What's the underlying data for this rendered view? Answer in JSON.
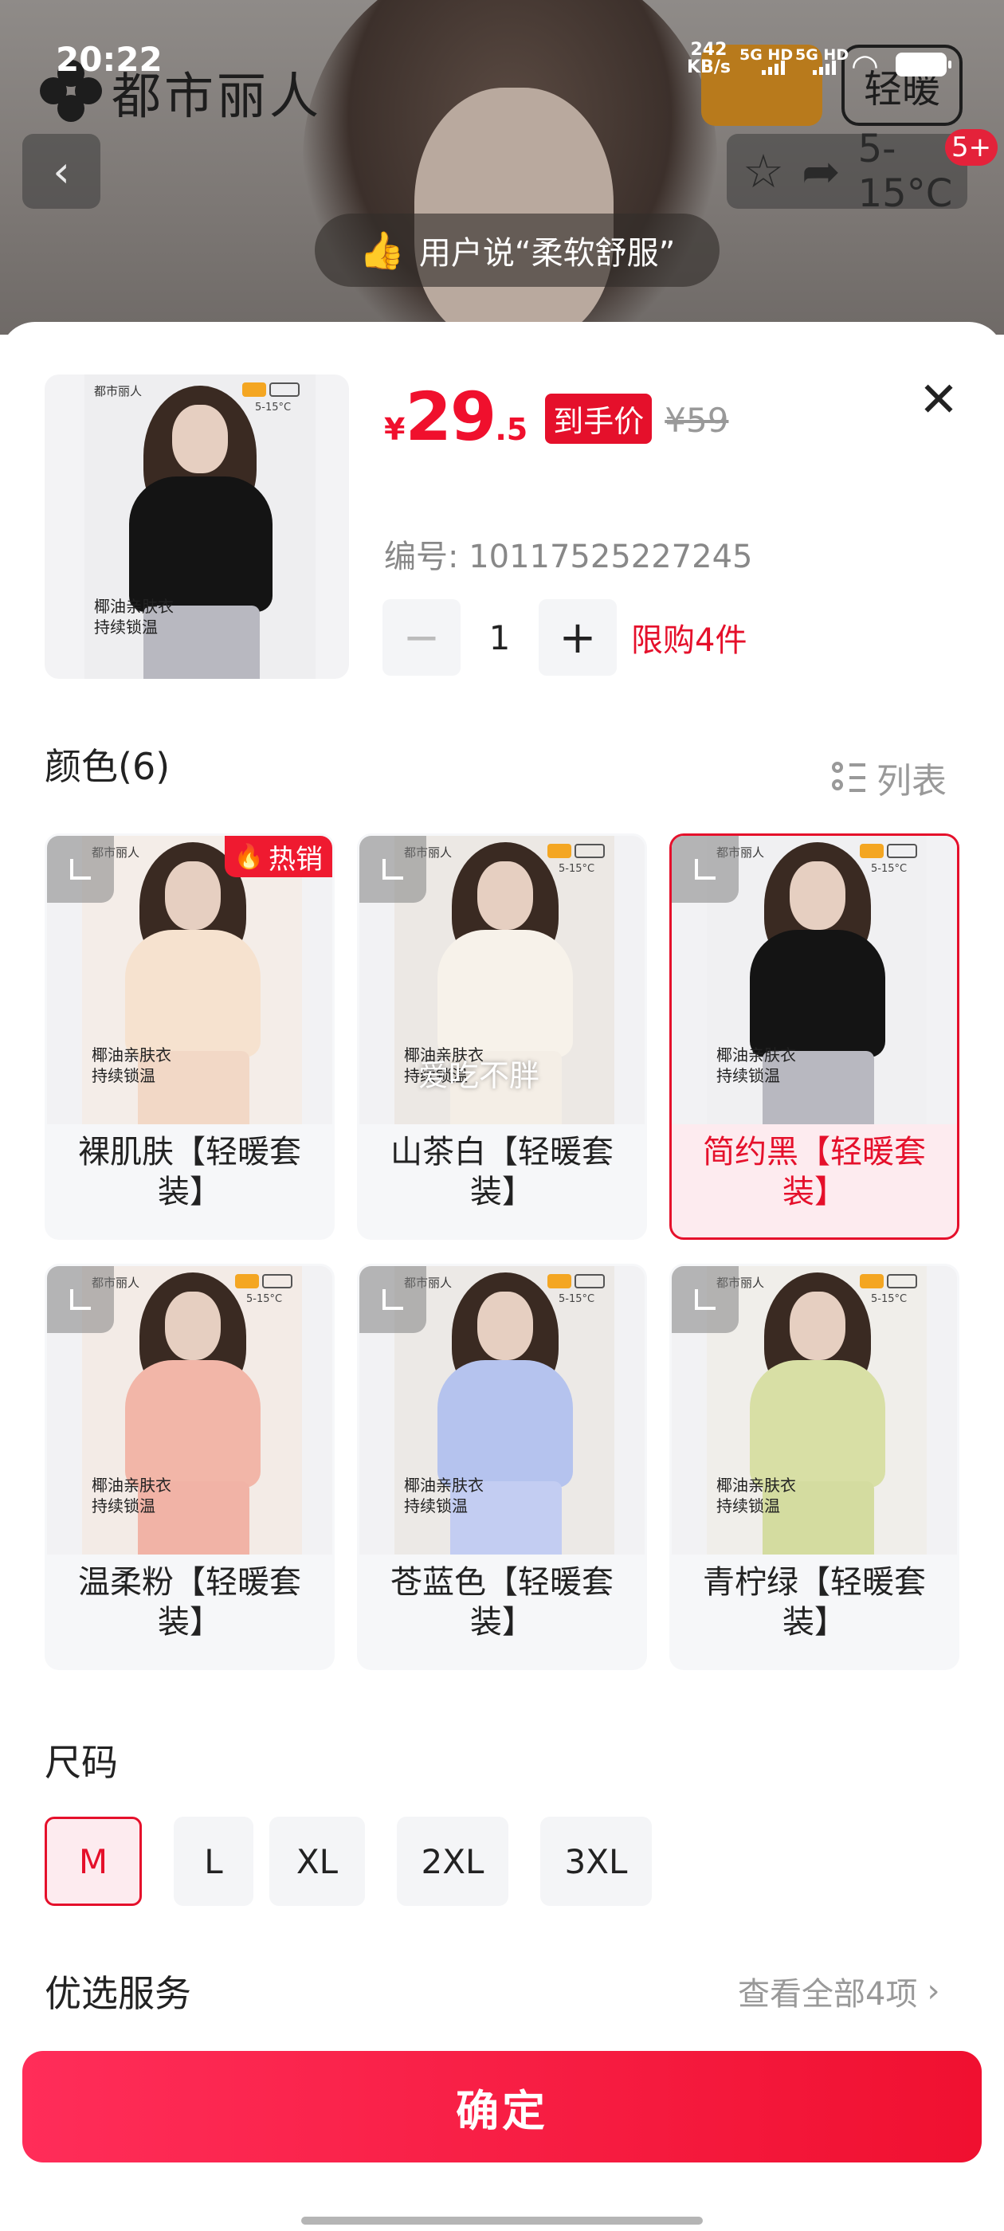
{
  "status_bar": {
    "time": "20:22",
    "net_speed": "242",
    "net_speed_unit": "KB/s",
    "sim1": "5G HD",
    "sim2": "5G HD"
  },
  "background_page": {
    "brand": "都市丽人",
    "warm_badge": "轻暖",
    "back_icon": "chevron-left-icon",
    "temp_range": "5-15°C",
    "cart_count": "5+",
    "review_pill": "用户说“柔软舒服”"
  },
  "sheet": {
    "close_icon": "close-icon",
    "price": {
      "currency": "¥",
      "integer": "29",
      "decimal": ".5",
      "tag": "到手价",
      "original": "¥59"
    },
    "sku": "编号: 10117525227245",
    "quantity": {
      "minus": "−",
      "value": "1",
      "plus": "+",
      "limit": "限购4件"
    },
    "color_section": {
      "title": "颜色(6)",
      "list_toggle": "列表",
      "hot_badge": "热销",
      "photo_text": {
        "brand": "都市丽人",
        "range": "5-15°C",
        "slogan_line1": "椰油亲肤衣",
        "slogan_line2": "持续锁温"
      },
      "items": [
        {
          "label": "裸肌肤【轻暖套装】",
          "top": "#f6e2cf",
          "bottom": "#f2d8c6",
          "bg": "#f4ede8",
          "selected": false,
          "hot": true
        },
        {
          "label": "山茶白【轻暖套装】",
          "top": "#f7f2ea",
          "bottom": "#f4eee6",
          "bg": "#ece8e4",
          "selected": false,
          "hot": false,
          "overlay_text": "爱吃不胖"
        },
        {
          "label": "简约黑【轻暖套装】",
          "top": "#141414",
          "bottom": "#b8b8c0",
          "bg": "#f0f0f2",
          "selected": true,
          "hot": false
        },
        {
          "label": "温柔粉【轻暖套装】",
          "top": "#f2b6a8",
          "bottom": "#f1b3a6",
          "bg": "#f3ebe6",
          "selected": false,
          "hot": false
        },
        {
          "label": "苍蓝色【轻暖套装】",
          "top": "#b5c3ee",
          "bottom": "#c3cdf2",
          "bg": "#ece9e6",
          "selected": false,
          "hot": false
        },
        {
          "label": "青柠绿【轻暖套装】",
          "top": "#d8dfa5",
          "bottom": "#d4dca0",
          "bg": "#f0eeea",
          "selected": false,
          "hot": false
        }
      ]
    },
    "size_section": {
      "title": "尺码",
      "options": [
        {
          "label": "M",
          "selected": true
        },
        {
          "label": "L",
          "selected": false
        },
        {
          "label": "XL",
          "selected": false
        },
        {
          "label": "2XL",
          "selected": false
        },
        {
          "label": "3XL",
          "selected": false
        }
      ]
    },
    "service_section": {
      "title": "优选服务",
      "more": "查看全部4项",
      "chevron": "›"
    },
    "confirm": "确定"
  },
  "colors": {
    "accent": "#e5102b",
    "confirm_gradient_start": "#ff2d59",
    "confirm_gradient_end": "#f01030"
  }
}
